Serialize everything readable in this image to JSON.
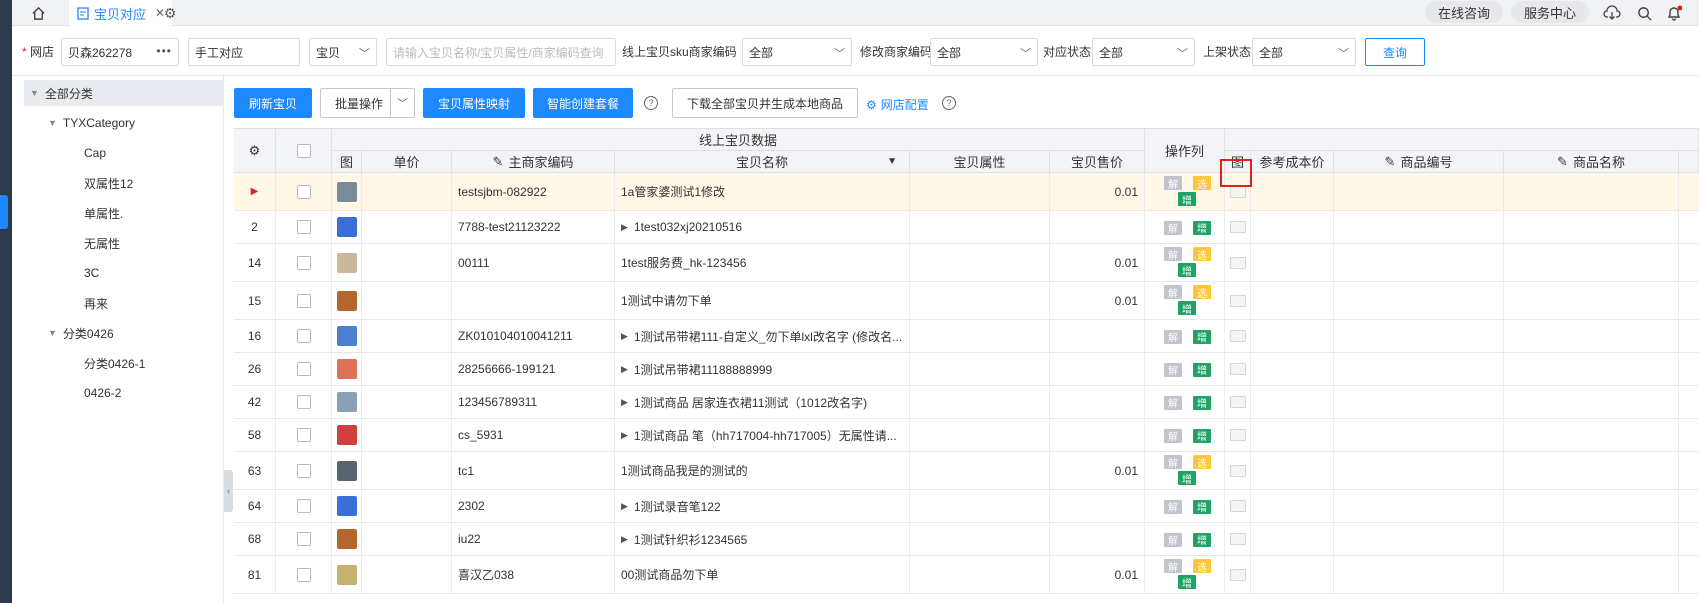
{
  "topbar": {
    "tab_title": "宝贝对应",
    "online_consult": "在线咨询",
    "service_center": "服务中心",
    "icons": [
      "home-icon",
      "file-tab-icon",
      "close-icon",
      "settings-icon",
      "download-icon",
      "search-icon",
      "bell-icon"
    ]
  },
  "filters": {
    "shop_label": "网店",
    "shop_value": "贝森262278",
    "mode_value": "手工对应",
    "type_value": "宝贝",
    "search_placeholder": "请输入宝贝名称/宝贝属性/商家编码查询",
    "sku_label": "线上宝贝sku商家编码",
    "sku_value": "全部",
    "modify_label": "修改商家编码",
    "modify_value": "全部",
    "match_label": "对应状态",
    "match_value": "全部",
    "shelf_label": "上架状态",
    "shelf_value": "全部",
    "query_btn": "查询"
  },
  "tree": {
    "root": "全部分类",
    "groups": [
      {
        "label": "TYXCategory",
        "children": [
          "Cap",
          "双属性12",
          "单属性.",
          "无属性",
          "3C",
          "再来"
        ]
      },
      {
        "label": "分类0426",
        "children": [
          "分类0426-1",
          "0426-2"
        ]
      }
    ]
  },
  "toolbar": {
    "refresh": "刷新宝贝",
    "batch": "批量操作",
    "attr_map": "宝贝属性映射",
    "smart_bundle": "智能创建套餐",
    "download_all": "下载全部宝贝并生成本地商品",
    "shop_config": "网店配置"
  },
  "table": {
    "group_online": "线上宝贝数据",
    "group_ops": "操作列",
    "headers": {
      "img": "图",
      "unit_price": "单价",
      "main_code": "主商家编码",
      "item_name": "宝贝名称",
      "item_attr": "宝贝属性",
      "item_price": "宝贝售价",
      "img2": "图",
      "ref_cost": "参考成本价",
      "goods_code": "商品编号",
      "goods_name": "商品名称"
    },
    "tags": {
      "jie": "解",
      "xuan": "选",
      "zeng": "增"
    },
    "rows": [
      {
        "no": "▶",
        "code": "testsjbm-082922",
        "name": "1a管家婆测试1修改",
        "expand": false,
        "price": "0.01",
        "xuan": true,
        "thumb": "#7a8a99"
      },
      {
        "no": "2",
        "code": "7788-test21123222",
        "name": "1test032xj20210516",
        "expand": true,
        "price": "",
        "xuan": false,
        "thumb": "#3b6fd8"
      },
      {
        "no": "14",
        "code": "00111",
        "name": "1test服务费_hk-123456",
        "expand": false,
        "price": "0.01",
        "xuan": true,
        "thumb": "#c9b89a"
      },
      {
        "no": "15",
        "code": "",
        "name": "1测试中请勿下单",
        "expand": false,
        "price": "0.01",
        "xuan": true,
        "thumb": "#b5652e"
      },
      {
        "no": "16",
        "code": "ZK010104010041211",
        "name": "1测试吊带裙111-自定义_勿下单lxl改名字 (修改名...",
        "expand": true,
        "price": "",
        "xuan": false,
        "thumb": "#4a7fcf"
      },
      {
        "no": "26",
        "code": "28256666-199121",
        "name": "1测试吊带裙11188888999",
        "expand": true,
        "price": "",
        "xuan": false,
        "thumb": "#e0705a"
      },
      {
        "no": "42",
        "code": "123456789311",
        "name": "1测试商品 居家连衣裙11测试（1012改名字)",
        "expand": true,
        "price": "",
        "xuan": false,
        "thumb": "#8aa0b8"
      },
      {
        "no": "58",
        "code": "cs_5931",
        "name": "1测试商品 笔（hh717004-hh717005）无属性请...",
        "expand": true,
        "price": "",
        "xuan": false,
        "thumb": "#d04040"
      },
      {
        "no": "63",
        "code": "tc1",
        "name": "1测试商品我是的测试的",
        "expand": false,
        "price": "0.01",
        "xuan": true,
        "thumb": "#5a6470"
      },
      {
        "no": "64",
        "code": "2302",
        "name": "1测试录音笔122",
        "expand": true,
        "price": "",
        "xuan": false,
        "thumb": "#3b6fd8"
      },
      {
        "no": "68",
        "code": "iu22",
        "name": "1测试针织衫1234565",
        "expand": true,
        "price": "",
        "xuan": false,
        "thumb": "#b5652e"
      },
      {
        "no": "81",
        "code": "喜汉乙038",
        "name": "00测试商品勿下单",
        "expand": false,
        "price": "0.01",
        "xuan": true,
        "thumb": "#c8b070"
      }
    ]
  }
}
